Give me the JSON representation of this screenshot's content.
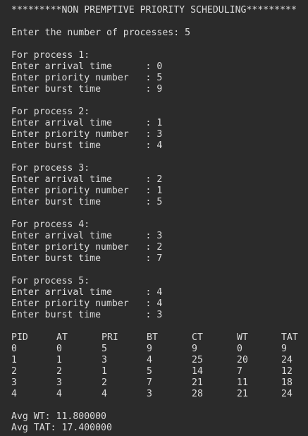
{
  "title": "*********NON PREMPTIVE PRIORITY SCHEDULING*********",
  "prompt_num": "Enter the number of processes: 5",
  "processes": [
    {
      "header": "For process 1:",
      "arrival": "Enter arrival time      : 0",
      "priority": "Enter priority number   : 5",
      "burst": "Enter burst time        : 9"
    },
    {
      "header": "For process 2:",
      "arrival": "Enter arrival time      : 1",
      "priority": "Enter priority number   : 3",
      "burst": "Enter burst time        : 4"
    },
    {
      "header": "For process 3:",
      "arrival": "Enter arrival time      : 2",
      "priority": "Enter priority number   : 1",
      "burst": "Enter burst time        : 5"
    },
    {
      "header": "For process 4:",
      "arrival": "Enter arrival time      : 3",
      "priority": "Enter priority number   : 2",
      "burst": "Enter burst time        : 7"
    },
    {
      "header": "For process 5:",
      "arrival": "Enter arrival time      : 4",
      "priority": "Enter priority number   : 4",
      "burst": "Enter burst time        : 3"
    }
  ],
  "table": {
    "headers": [
      "PID",
      "AT",
      "PRI",
      "BT",
      "CT",
      "WT",
      "TAT"
    ],
    "rows": [
      [
        "0",
        "0",
        "5",
        "9",
        "9",
        "0",
        "9"
      ],
      [
        "1",
        "1",
        "3",
        "4",
        "25",
        "20",
        "24"
      ],
      [
        "2",
        "2",
        "1",
        "5",
        "14",
        "7",
        "12"
      ],
      [
        "3",
        "3",
        "2",
        "7",
        "21",
        "11",
        "18"
      ],
      [
        "4",
        "4",
        "4",
        "3",
        "28",
        "21",
        "24"
      ]
    ]
  },
  "avg_wt": "Avg WT: 11.800000",
  "avg_tat": "Avg TAT: 17.400000",
  "colors": {
    "background": "#2b2b2b",
    "text": "#dcdcdc",
    "prompt_accent": "#c8b13a"
  }
}
